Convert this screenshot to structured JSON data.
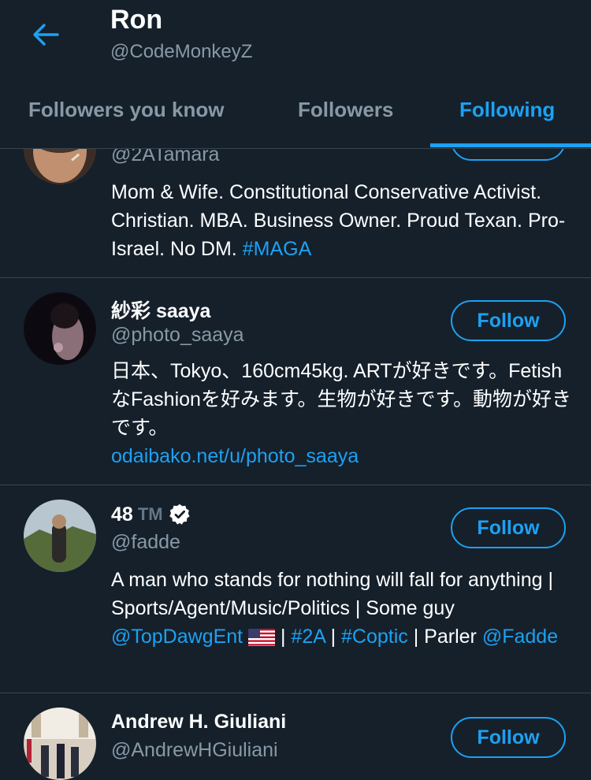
{
  "header": {
    "title": "Ron",
    "handle": "@CodeMonkeyZ",
    "back_icon": "arrow-left-icon"
  },
  "tabs": [
    {
      "label": "Followers you know",
      "active": false
    },
    {
      "label": "Followers",
      "active": false
    },
    {
      "label": "Following",
      "active": true
    }
  ],
  "colors": {
    "background": "#15202b",
    "accent": "#1da1f2",
    "secondary_text": "#8899a6",
    "divider": "#38444d"
  },
  "users": [
    {
      "handle": "@2ATamara",
      "bio": "Mom & Wife. Constitutional Conservative Activist. Christian. MBA. Business Owner. Proud Texan. Pro-Israel. No DM.",
      "bio_hashtag": "#MAGA"
    },
    {
      "name": "紗彩 saaya",
      "handle": "@photo_saaya",
      "follow_label": "Follow",
      "bio": "日本、Tokyo、160cm45kg. ARTが好きです。FetishなFashionを好みます。生物が好きです。動物が好きです。",
      "bio_link": "odaibako.net/u/photo_saaya"
    },
    {
      "name": "48",
      "name_suffix": "TM",
      "verified": true,
      "handle": "@fadde",
      "follow_label": "Follow",
      "bio_text": "A man who stands for nothing will fall for anything | Sports/Agent/Music/Politics | Some guy",
      "bio_mention": "@TopDawgEnt",
      "bio_sep1": "|",
      "bio_tag1": "#2A",
      "bio_sep2": "|",
      "bio_tag2": "#Coptic",
      "bio_tail": "| Parler",
      "bio_mention2": "@Fadde"
    },
    {
      "name": "Andrew H. Giuliani",
      "handle": "@AndrewHGiuliani",
      "follow_label": "Follow"
    }
  ]
}
